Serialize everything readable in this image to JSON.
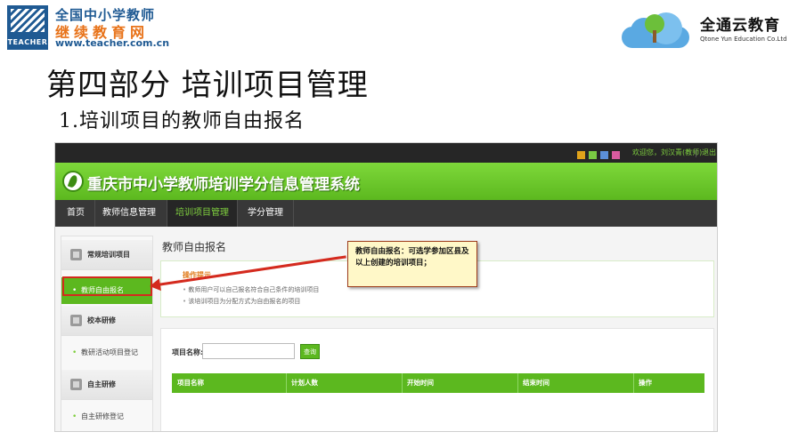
{
  "header": {
    "logo_left": {
      "mark_text": "TEACHER",
      "line1": "全国中小学教师",
      "line2": "继续教育网",
      "url": "www.teacher.com.cn"
    },
    "logo_right": {
      "name_cn": "全通云教育",
      "name_en": "Qtone Yun Education Co.Ltd"
    }
  },
  "slide": {
    "title": "第四部分   培训项目管理",
    "subtitle": "1.培训项目的教师自由报名"
  },
  "app": {
    "topbar": {
      "welcome": "欢迎您，刘汉青(教师)",
      "logout": "退出",
      "theme_colors": [
        "#e0a21a",
        "#7ac943",
        "#5b8fd8",
        "#d85ba0"
      ]
    },
    "system_title": "重庆市中小学教师培训学分信息管理系统",
    "nav": [
      {
        "label": "首页",
        "active": false
      },
      {
        "label": "教师信息管理",
        "active": false
      },
      {
        "label": "培训项目管理",
        "active": true
      },
      {
        "label": "学分管理",
        "active": false
      }
    ],
    "sidebar": {
      "groups": [
        {
          "label": "常规培训项目",
          "items": [
            {
              "label": "教师自由报名",
              "active": true
            }
          ]
        },
        {
          "label": "校本研修",
          "items": [
            {
              "label": "教研活动项目登记",
              "active": false
            }
          ]
        },
        {
          "label": "自主研修",
          "items": [
            {
              "label": "自主研修登记",
              "active": false
            }
          ]
        }
      ]
    },
    "main": {
      "title": "教师自由报名",
      "tips_heading": "操作提示",
      "tips": [
        "教师用户可以自己报名符合自己条件的培训项目",
        "该培训项目为分配方式为自由报名的项目"
      ],
      "search": {
        "label": "项目名称:",
        "value": "",
        "button": "查询"
      },
      "table_headers": [
        "项目名称",
        "计划人数",
        "开始时间",
        "结束时间",
        "操作"
      ]
    }
  },
  "annotation": {
    "callout_text": "教师自由报名：可选学参加区县及以上创建的培训项目；",
    "colors": {
      "highlight": "#d42a1e",
      "callout_bg": "#fff8c8"
    }
  },
  "colors": {
    "accent_green": "#5cb81f",
    "nav_bg": "#383838",
    "topbar_bg": "#262626"
  }
}
